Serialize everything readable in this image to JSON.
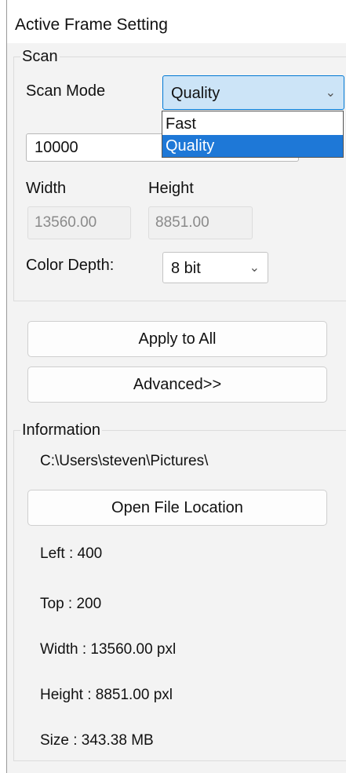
{
  "window": {
    "title": "Active Frame Setting"
  },
  "scan": {
    "group_title": "Scan",
    "scan_mode_label": "Scan Mode",
    "scan_mode_value": "Quality",
    "scan_mode_options": [
      "Fast",
      "Quality"
    ],
    "selected_option": "Quality",
    "resolution_value": "10000",
    "width_label": "Width",
    "height_label": "Height",
    "width_value": "13560.00",
    "height_value": "8851.00",
    "color_depth_label": "Color Depth:",
    "color_depth_value": "8 bit"
  },
  "buttons": {
    "apply_all": "Apply to All",
    "advanced": "Advanced>>",
    "open_file_location": "Open File Location"
  },
  "information": {
    "group_title": "Information",
    "path": "C:\\Users\\steven\\Pictures\\",
    "left": "Left : 400",
    "top": "Top : 200",
    "width": "Width : 13560.00 pxl",
    "height": "Height : 8851.00 pxl",
    "size": "Size : 343.38 MB"
  },
  "colors": {
    "accent": "#1e78d7",
    "combo_active_bg": "#cce4f7",
    "combo_active_border": "#0078d4"
  },
  "icons": {
    "dropdown": "chevron-down-icon"
  }
}
